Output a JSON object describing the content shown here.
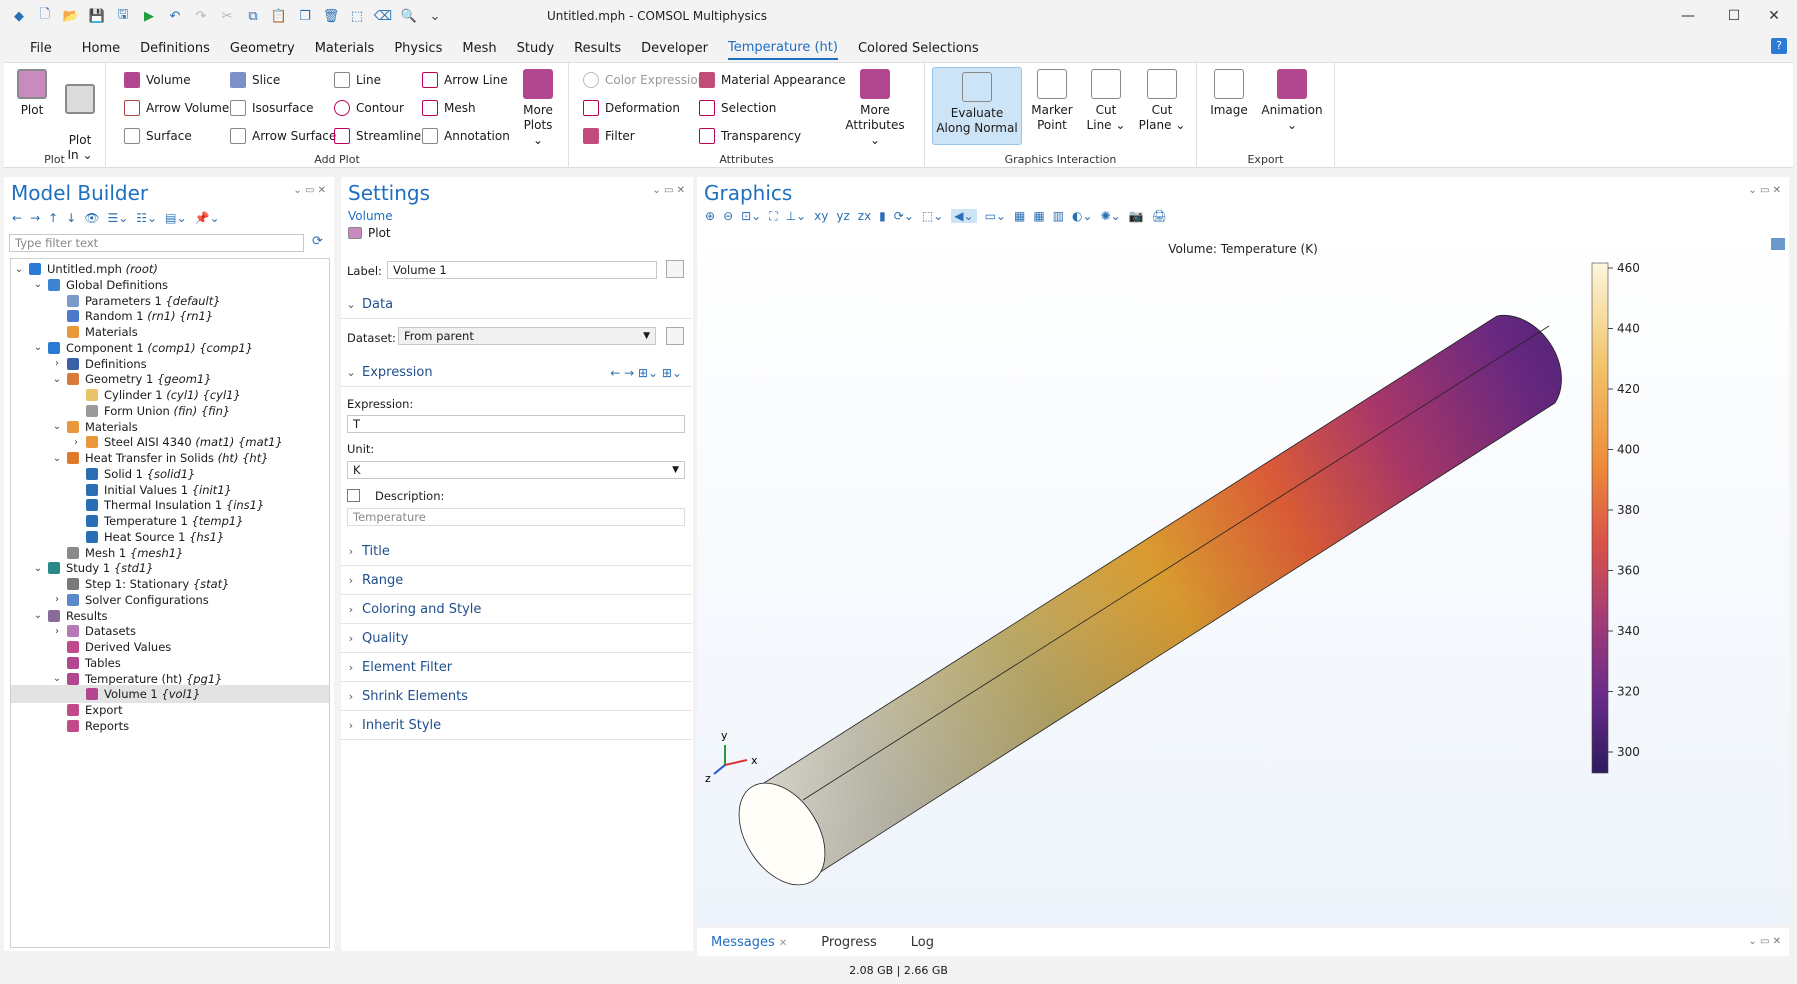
{
  "window": {
    "title": "Untitled.mph - COMSOL Multiphysics"
  },
  "menu": [
    "File",
    "Home",
    "Definitions",
    "Geometry",
    "Materials",
    "Physics",
    "Mesh",
    "Study",
    "Results",
    "Developer",
    "Temperature (ht)",
    "Colored Selections"
  ],
  "ribbon": {
    "plot_group": {
      "label": "Plot",
      "plot": "Plot",
      "plot_in": "Plot\nIn ⌄"
    },
    "add_plot": {
      "label": "Add Plot",
      "items": [
        "Volume",
        "Slice",
        "Line",
        "Arrow Line",
        "Arrow Volume",
        "Isosurface",
        "Contour",
        "Mesh",
        "Surface",
        "Arrow Surface",
        "Streamline",
        "Annotation"
      ],
      "more": "More Plots"
    },
    "attributes": {
      "label": "Attributes",
      "items": [
        "Color Expression",
        "Material Appearance",
        "Deformation",
        "Selection",
        "Filter",
        "Transparency"
      ],
      "more": "More Attributes"
    },
    "graphics_interaction": {
      "label": "Graphics Interaction",
      "items": [
        "Evaluate Along Normal",
        "Marker Point",
        "Cut Line",
        "Cut Plane"
      ]
    },
    "export": {
      "label": "Export",
      "items": [
        "Image",
        "Animation"
      ]
    }
  },
  "model_builder": {
    "title": "Model Builder",
    "filter_placeholder": "Type filter text",
    "nodes": [
      {
        "t": "Untitled.mph",
        "s": "(root)"
      },
      {
        "t": "Global Definitions",
        "s": ""
      },
      {
        "t": "Parameters 1",
        "s": "{default}"
      },
      {
        "t": "Random 1",
        "s": "(rn1) {rn1}"
      },
      {
        "t": "Materials",
        "s": ""
      },
      {
        "t": "Component 1",
        "s": "(comp1) {comp1}"
      },
      {
        "t": "Definitions",
        "s": ""
      },
      {
        "t": "Geometry 1",
        "s": "{geom1}"
      },
      {
        "t": "Cylinder 1",
        "s": "(cyl1) {cyl1}"
      },
      {
        "t": "Form Union",
        "s": "(fin) {fin}"
      },
      {
        "t": "Materials",
        "s": ""
      },
      {
        "t": "Steel AISI 4340",
        "s": "(mat1) {mat1}"
      },
      {
        "t": "Heat Transfer in Solids",
        "s": "(ht) {ht}"
      },
      {
        "t": "Solid 1",
        "s": "{solid1}"
      },
      {
        "t": "Initial Values 1",
        "s": "{init1}"
      },
      {
        "t": "Thermal Insulation 1",
        "s": "{ins1}"
      },
      {
        "t": "Temperature 1",
        "s": "{temp1}"
      },
      {
        "t": "Heat Source 1",
        "s": "{hs1}"
      },
      {
        "t": "Mesh 1",
        "s": "{mesh1}"
      },
      {
        "t": "Study 1",
        "s": "{std1}"
      },
      {
        "t": "Step 1: Stationary",
        "s": "{stat}"
      },
      {
        "t": "Solver Configurations",
        "s": ""
      },
      {
        "t": "Results",
        "s": ""
      },
      {
        "t": "Datasets",
        "s": ""
      },
      {
        "t": "Derived Values",
        "s": ""
      },
      {
        "t": "Tables",
        "s": ""
      },
      {
        "t": "Temperature (ht)",
        "s": "{pg1}"
      },
      {
        "t": "Volume 1",
        "s": "{vol1}"
      },
      {
        "t": "Export",
        "s": ""
      },
      {
        "t": "Reports",
        "s": ""
      }
    ]
  },
  "settings": {
    "title": "Settings",
    "subtitle": "Volume",
    "plot_btn": "Plot",
    "label_caption": "Label:",
    "label_value": "Volume 1",
    "data_section": "Data",
    "dataset_caption": "Dataset:",
    "dataset_value": "From parent",
    "expression_section": "Expression",
    "expression_caption": "Expression:",
    "expression_value": "T",
    "unit_caption": "Unit:",
    "unit_value": "K",
    "description_caption": "Description:",
    "description_placeholder": "Temperature",
    "sections": [
      "Title",
      "Range",
      "Coloring and Style",
      "Quality",
      "Element Filter",
      "Shrink Elements",
      "Inherit Style"
    ]
  },
  "graphics": {
    "title": "Graphics",
    "plot_title": "Volume: Temperature (K)",
    "colorbar_ticks": [
      "460",
      "440",
      "420",
      "400",
      "380",
      "360",
      "340",
      "320",
      "300"
    ],
    "axes": {
      "x": "x",
      "y": "y",
      "z": "z"
    }
  },
  "bottom_tabs": [
    "Messages",
    "Progress",
    "Log"
  ],
  "status": "2.08 GB | 2.66 GB"
}
